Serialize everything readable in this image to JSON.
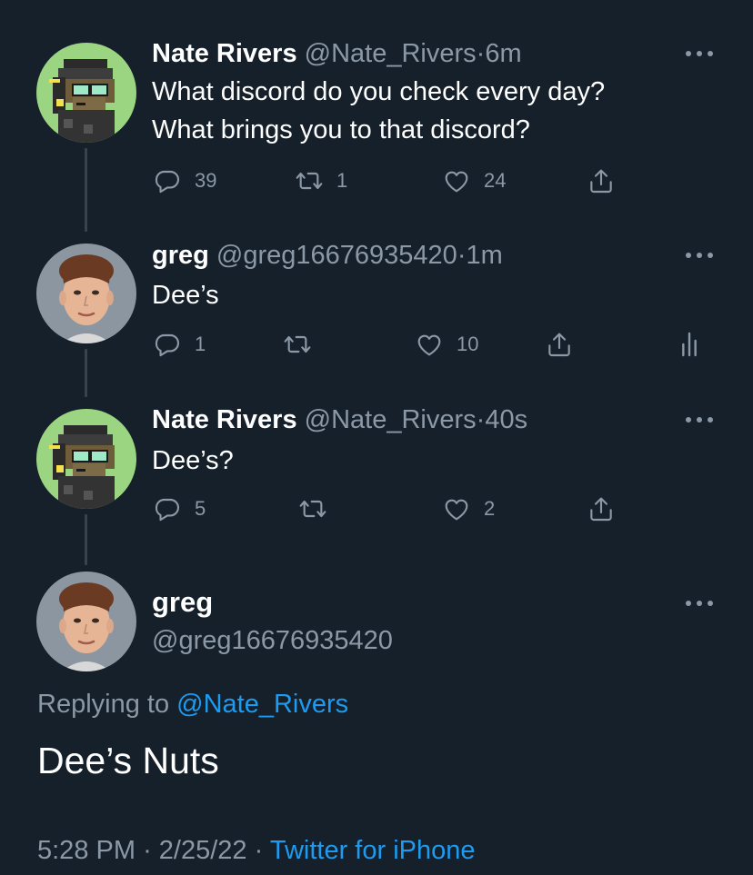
{
  "tweets": [
    {
      "name": "Nate Rivers",
      "handle": "@Nate_Rivers",
      "separator": "·",
      "time": "6m",
      "lines": [
        "What discord do you check every day?",
        "What brings you to that discord?"
      ],
      "replies": "39",
      "retweets": "1",
      "likes": "24"
    },
    {
      "name": "greg",
      "handle": "@greg16676935420",
      "separator": "·",
      "time": "1m",
      "lines": [
        "Dee’s"
      ],
      "replies": "1",
      "retweets": "",
      "likes": "10"
    },
    {
      "name": "Nate Rivers",
      "handle": "@Nate_Rivers",
      "separator": "·",
      "time": "40s",
      "lines": [
        "Dee’s?"
      ],
      "replies": "5",
      "retweets": "",
      "likes": "2"
    }
  ],
  "focus": {
    "name": "greg",
    "handle": "@greg16676935420",
    "replying_prefix": "Replying to",
    "replying_to": "@Nate_Rivers",
    "text": "Dee’s Nuts",
    "time": "5:28 PM",
    "separator": "·",
    "date": "2/25/22",
    "source": "Twitter for iPhone"
  },
  "icons": {
    "reply": "reply-icon",
    "retweet": "retweet-icon",
    "like": "heart-icon",
    "share": "share-icon",
    "analytics": "analytics-icon",
    "more": "more-icon"
  },
  "colors": {
    "background": "#15202b",
    "text_primary": "#ffffff",
    "text_secondary": "#8b98a5",
    "accent": "#1d9bf0",
    "thread_line": "#38444d"
  }
}
